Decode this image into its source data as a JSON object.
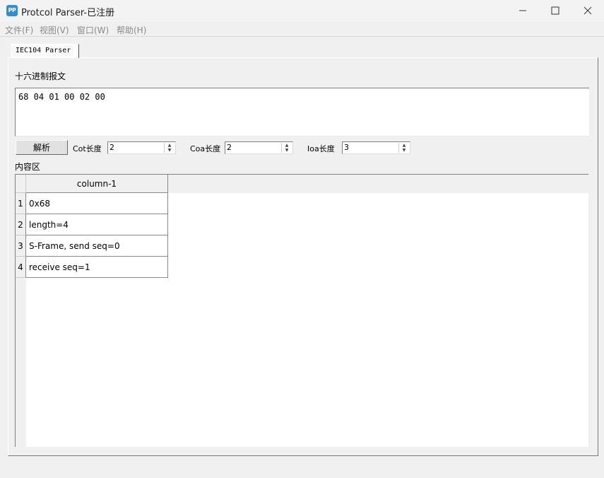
{
  "window": {
    "icon_text": "PP",
    "title": "Protcol Parser-已注册"
  },
  "menu": [
    "文件(F)",
    "视图(V)",
    "窗口(W)",
    "帮助(H)"
  ],
  "tab": {
    "label": "IEC104 Parser"
  },
  "hex": {
    "label": "十六进制报文",
    "value": "68 04 01 00 02 00"
  },
  "controls": {
    "parse_label": "解析",
    "cot": {
      "label": "Cot长度",
      "value": "2"
    },
    "coa": {
      "label": "Coa长度",
      "value": "2"
    },
    "ioa": {
      "label": "Ioa长度",
      "value": "3"
    }
  },
  "content": {
    "label": "内容区",
    "columns": [
      "column-1"
    ],
    "rows": [
      {
        "num": "1",
        "value": "0x68"
      },
      {
        "num": "2",
        "value": "length=4"
      },
      {
        "num": "3",
        "value": "S-Frame, send seq=0"
      },
      {
        "num": "4",
        "value": "receive seq=1"
      }
    ]
  },
  "icons": {
    "minimize": "minimize-icon",
    "maximize": "maximize-icon",
    "close": "close-icon"
  }
}
